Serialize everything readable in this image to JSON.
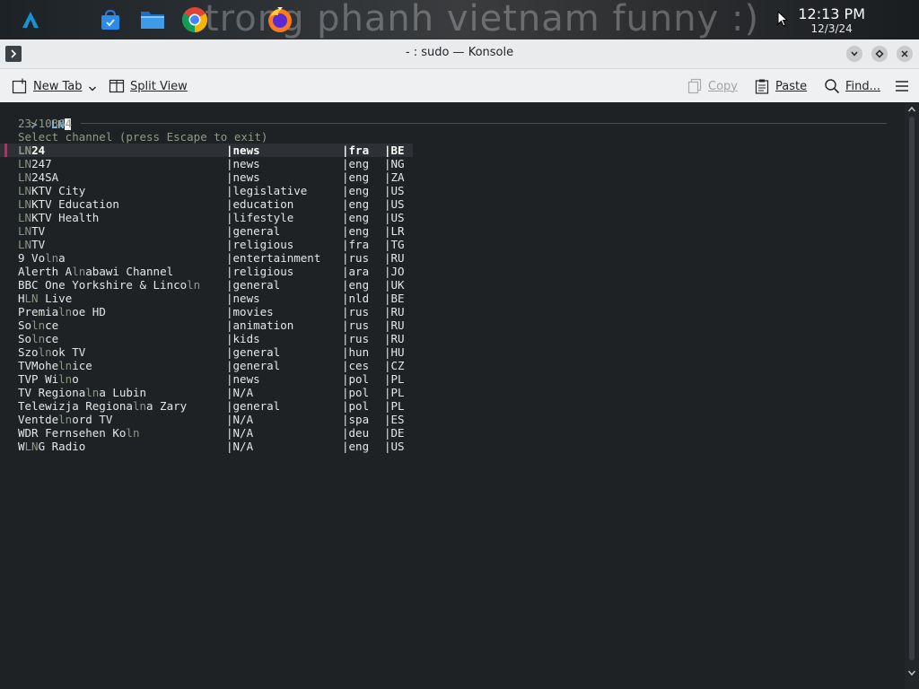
{
  "taskbar": {
    "wallpaper_text": "trong phanh vietnam funny :)",
    "clock_time": "12:13 PM",
    "clock_date": "12/3/24",
    "apps": [
      "app-launcher-icon",
      "store-icon",
      "file-manager-icon",
      "chrome-icon",
      "firefox-icon"
    ]
  },
  "window": {
    "title": "- : sudo — Konsole"
  },
  "toolbar": {
    "new_tab": "New Tab",
    "split_view": "Split View",
    "copy": "Copy",
    "paste": "Paste",
    "find": "Find..."
  },
  "terminal": {
    "prompt": ">",
    "query": "LN",
    "count": "23/10364",
    "hint": "Select channel (press Escape to exit)",
    "channels": [
      {
        "pre": "",
        "hl": "LN",
        "post": "24",
        "cat": "|news",
        "lang": "|fra",
        "cc": "|BE"
      },
      {
        "pre": "",
        "hl": "LN",
        "post": "247",
        "cat": "|news",
        "lang": "|eng",
        "cc": "|NG"
      },
      {
        "pre": "",
        "hl": "LN",
        "post": "24SA",
        "cat": "|news",
        "lang": "|eng",
        "cc": "|ZA"
      },
      {
        "pre": "",
        "hl": "LN",
        "post": "KTV City",
        "cat": "|legislative",
        "lang": "|eng",
        "cc": "|US"
      },
      {
        "pre": "",
        "hl": "LN",
        "post": "KTV Education",
        "cat": "|education",
        "lang": "|eng",
        "cc": "|US"
      },
      {
        "pre": "",
        "hl": "LN",
        "post": "KTV Health",
        "cat": "|lifestyle",
        "lang": "|eng",
        "cc": "|US"
      },
      {
        "pre": "",
        "hl": "LN",
        "post": "TV",
        "cat": "|general",
        "lang": "|eng",
        "cc": "|LR"
      },
      {
        "pre": "",
        "hl": "LN",
        "post": "TV",
        "cat": "|religious",
        "lang": "|fra",
        "cc": "|TG"
      },
      {
        "pre": "9 Vo",
        "hl": "ln",
        "post": "a",
        "cat": "|entertainment",
        "lang": "|rus",
        "cc": "|RU"
      },
      {
        "pre": "Alerth A",
        "hl": "ln",
        "post": "abawi Channel",
        "cat": "|religious",
        "lang": "|ara",
        "cc": "|JO"
      },
      {
        "pre": "BBC One Yorkshire & Linco",
        "hl": "ln",
        "post": "",
        "cat": "|general",
        "lang": "|eng",
        "cc": "|UK"
      },
      {
        "pre": "H",
        "hl": "LN",
        "post": " Live",
        "cat": "|news",
        "lang": "|nld",
        "cc": "|BE"
      },
      {
        "pre": "Premia",
        "hl": "ln",
        "post": "oe HD",
        "cat": "|movies",
        "lang": "|rus",
        "cc": "|RU"
      },
      {
        "pre": "So",
        "hl": "ln",
        "post": "ce",
        "cat": "|animation",
        "lang": "|rus",
        "cc": "|RU"
      },
      {
        "pre": "So",
        "hl": "ln",
        "post": "ce",
        "cat": "|kids",
        "lang": "|rus",
        "cc": "|RU"
      },
      {
        "pre": "Szo",
        "hl": "ln",
        "post": "ok TV",
        "cat": "|general",
        "lang": "|hun",
        "cc": "|HU"
      },
      {
        "pre": "TVMohe",
        "hl": "ln",
        "post": "ice",
        "cat": "|general",
        "lang": "|ces",
        "cc": "|CZ"
      },
      {
        "pre": "TVP Wi",
        "hl": "ln",
        "post": "o",
        "cat": "|news",
        "lang": "|pol",
        "cc": "|PL"
      },
      {
        "pre": "TV Regiona",
        "hl": "ln",
        "post": "a Lubin",
        "cat": "|N/A",
        "lang": "|pol",
        "cc": "|PL"
      },
      {
        "pre": "Telewizja Regiona",
        "hl": "ln",
        "post": "a Zary",
        "cat": "|general",
        "lang": "|pol",
        "cc": "|PL"
      },
      {
        "pre": "Ventde",
        "hl": "ln",
        "post": "ord TV",
        "cat": "|N/A",
        "lang": "|spa",
        "cc": "|ES"
      },
      {
        "pre": "WDR Fernsehen Ko",
        "hl": "ln",
        "post": "",
        "cat": "|N/A",
        "lang": "|deu",
        "cc": "|DE"
      },
      {
        "pre": "W",
        "hl": "LN",
        "post": "G Radio",
        "cat": "|N/A",
        "lang": "|eng",
        "cc": "|US"
      }
    ]
  },
  "colors": {
    "selection_marker": "#d0206c",
    "terminal_bg": "#1f2225",
    "match_highlight": "#8a9484"
  }
}
